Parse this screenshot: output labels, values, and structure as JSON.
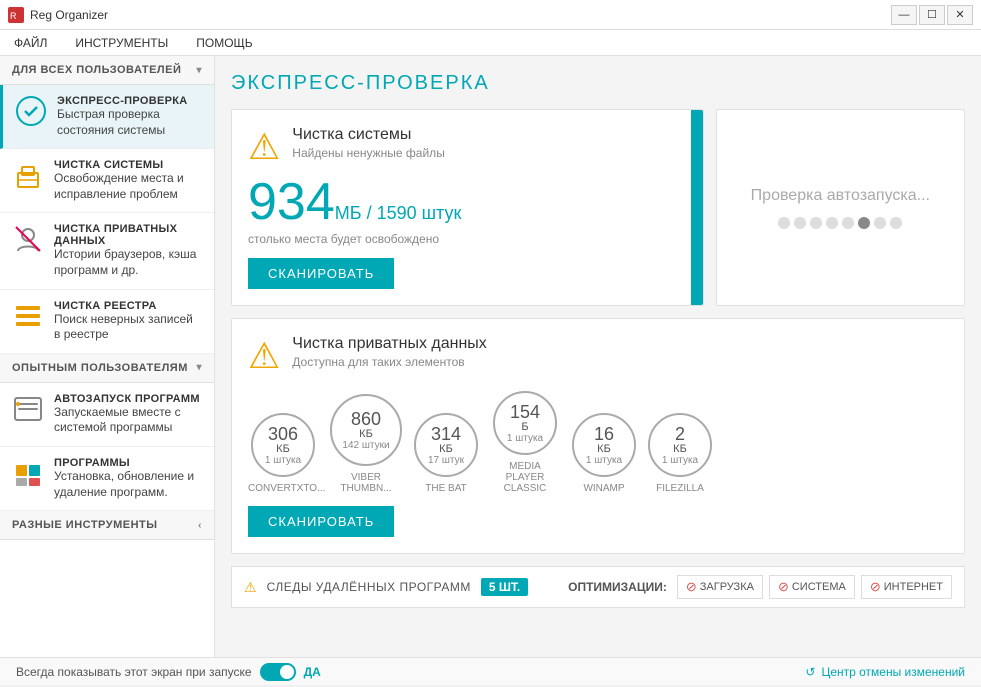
{
  "window": {
    "title": "Reg Organizer",
    "controls": [
      "—",
      "☐",
      "✕"
    ]
  },
  "menubar": {
    "items": [
      "ФАЙЛ",
      "ИНСТРУМЕНТЫ",
      "ПОМОЩЬ"
    ]
  },
  "sidebar": {
    "user_section_label": "ДЛЯ ВСЕХ ПОЛЬЗОВАТЕЛЕЙ",
    "expert_section_label": "ОПЫТНЫМ ПОЛЬЗОВАТЕЛЯМ",
    "misc_section_label": "РАЗНЫЕ ИНСТРУМЕНТЫ",
    "items_user": [
      {
        "id": "express",
        "title": "ЭКСПРЕСС-ПРОВЕРКА",
        "text": "Быстрая проверка состояния системы",
        "active": true
      },
      {
        "id": "clean-system",
        "title": "ЧИСТКА СИСТЕМЫ",
        "text": "Освобождение места и исправление проблем"
      },
      {
        "id": "clean-private",
        "title": "ЧИСТКА ПРИВАТНЫХ ДАННЫХ",
        "text": "Истории браузеров, кэша программ и др."
      },
      {
        "id": "clean-registry",
        "title": "ЧИСТКА РЕЕСТРА",
        "text": "Поиск неверных записей в реестре"
      }
    ],
    "items_expert": [
      {
        "id": "autorun",
        "title": "АВТОЗАПУСК ПРОГРАММ",
        "text": "Запускаемые вместе с системой программы"
      },
      {
        "id": "programs",
        "title": "ПРОГРАММЫ",
        "text": "Установка, обновление и удаление программ."
      }
    ]
  },
  "content": {
    "title": "ЭКСПРЕСС-ПРОВЕРКА",
    "clean_system": {
      "title": "Чистка системы",
      "subtitle": "Найдены ненужные файлы",
      "size": "934",
      "size_unit": "МБ / 1590 штук",
      "desc": "столько места будет освобождено",
      "btn": "СКАНИРОВАТЬ"
    },
    "autostart": {
      "text": "Проверка автозапуска..."
    },
    "private": {
      "title": "Чистка приватных данных",
      "subtitle": "Доступна для таких элементов",
      "btn": "СКАНИРОВАТЬ",
      "apps": [
        {
          "size": "306",
          "unit": "КБ",
          "count": "1 штука",
          "name": "CONVERTXTO..."
        },
        {
          "size": "860",
          "unit": "КБ",
          "count": "142 штуки",
          "name": "VIBER THUMBN..."
        },
        {
          "size": "314",
          "unit": "КБ",
          "count": "17 штук",
          "name": "THE BAT"
        },
        {
          "size": "154",
          "unit": "Б",
          "count": "1 штука",
          "name": "MEDIA PLAYER CLASSIC"
        },
        {
          "size": "16",
          "unit": "КБ",
          "count": "1 штука",
          "name": "WINAMP"
        },
        {
          "size": "2",
          "unit": "КБ",
          "count": "1 штука",
          "name": "FILEZILLA"
        }
      ]
    }
  },
  "bottom": {
    "deleted_label": "СЛЕДЫ УДАЛЁННЫХ ПРОГРАММ",
    "deleted_count": "5 ШТ.",
    "optimizations_label": "ОПТИМИЗАЦИИ:",
    "opt_items": [
      "ЗАГРУЗКА",
      "СИСТЕМА",
      "ИНТЕРНЕТ"
    ]
  },
  "statusbar": {
    "toggle_label": "Всегда показывать этот экран при запуске",
    "toggle_value": "ДА",
    "undo_label": "Центр отмены изменений"
  },
  "dots": [
    false,
    false,
    false,
    false,
    false,
    true,
    false,
    false
  ]
}
